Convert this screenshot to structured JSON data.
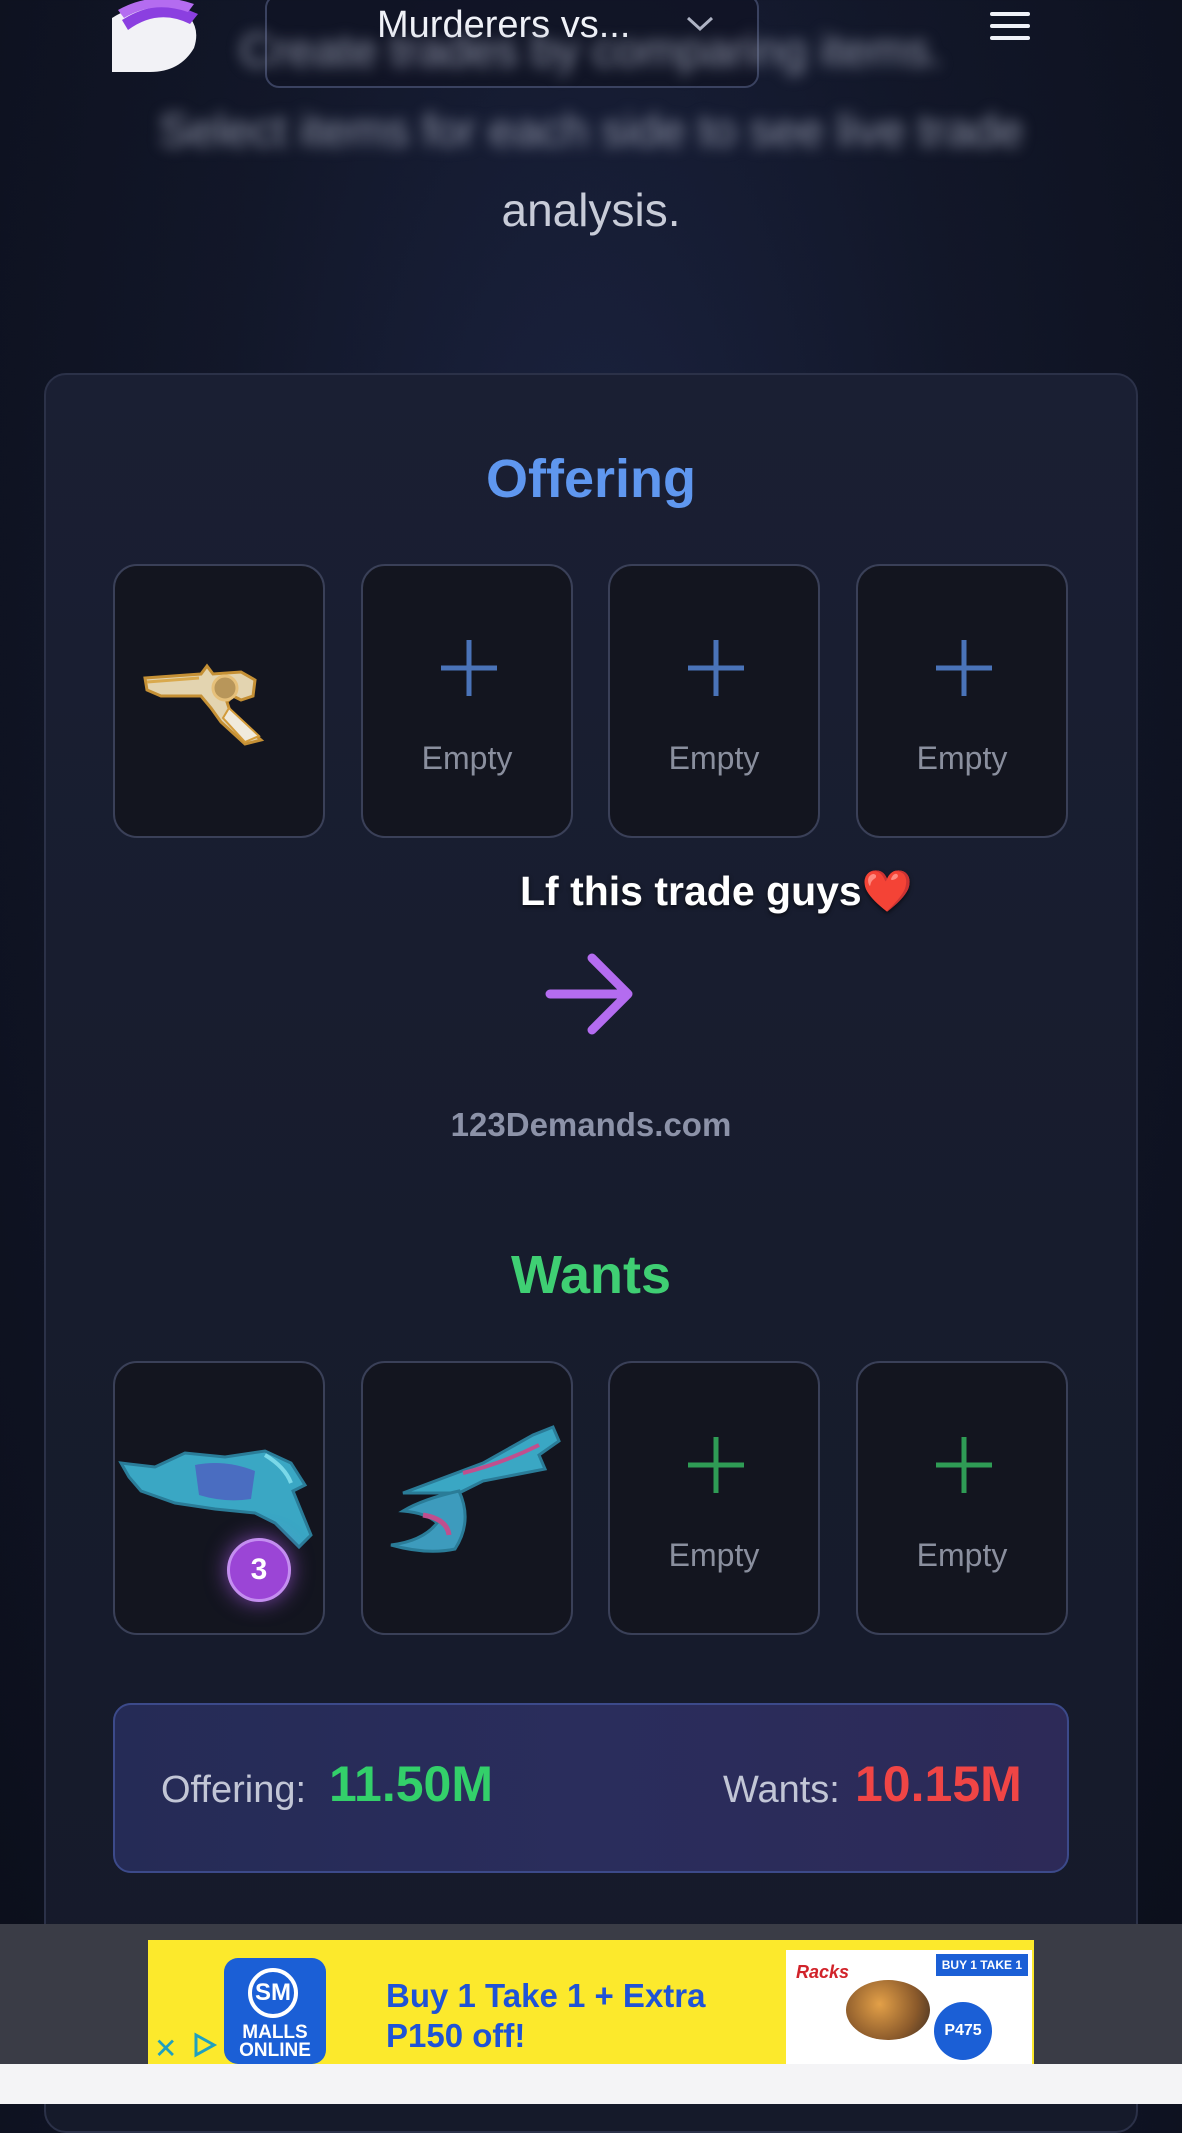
{
  "header": {
    "game_select_value": "Murderers vs...",
    "intro_blurred_line1": "Create trades by comparing items.",
    "intro_blurred_line2": "Select items for each side to see live trade",
    "intro_clear": "analysis."
  },
  "offering": {
    "title": "Offering",
    "slots": [
      {
        "item": "gold-revolver"
      },
      {
        "label": "Empty"
      },
      {
        "label": "Empty"
      },
      {
        "label": "Empty"
      }
    ]
  },
  "caption": "Lf this trade guys❤️",
  "site": "123Demands.com",
  "wants": {
    "title": "Wants",
    "slots": [
      {
        "item": "teal-blaster",
        "count": "3"
      },
      {
        "item": "teal-scythe"
      },
      {
        "label": "Empty"
      },
      {
        "label": "Empty"
      }
    ]
  },
  "totals": {
    "offering_label": "Offering:",
    "offering_value": "11.50M",
    "wants_label": "Wants:",
    "wants_value": "10.15M"
  },
  "ad": {
    "logo_top": "SM",
    "logo_bottom_1": "MALLS",
    "logo_bottom_2": "ONLINE",
    "headline_1": "Buy 1 Take 1 + Extra",
    "headline_2": "P150 off!",
    "brand": "Racks",
    "promo": "BUY 1 TAKE 1",
    "price": "P475"
  },
  "colors": {
    "offering": "#5f97ef",
    "wants": "#3fcf73",
    "offering_total": "#33d06a",
    "wants_total": "#f04545",
    "accent_arrow": "#b46cf0"
  }
}
